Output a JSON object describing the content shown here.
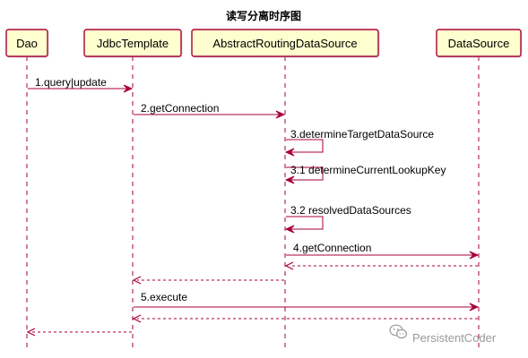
{
  "title": "读写分离时序图",
  "colors": {
    "participant_fill": "#FEFECE",
    "participant_border": "#A80036",
    "arrow": "#A80036",
    "lifeline": "#A80036"
  },
  "participants": [
    {
      "id": "dao",
      "name": "Dao"
    },
    {
      "id": "jdbc",
      "name": "JdbcTemplate"
    },
    {
      "id": "ards",
      "name": "AbstractRoutingDataSource"
    },
    {
      "id": "ds",
      "name": "DataSource"
    }
  ],
  "messages": [
    {
      "from": "dao",
      "to": "jdbc",
      "label": "1.query|update",
      "dashed": false
    },
    {
      "from": "jdbc",
      "to": "ards",
      "label": "2.getConnection",
      "dashed": false
    },
    {
      "from": "ards",
      "to": "ards",
      "label": "3.determineTargetDataSource",
      "dashed": false
    },
    {
      "from": "ards",
      "to": "ards",
      "label": "3.1 determineCurrentLookupKey",
      "dashed": false
    },
    {
      "from": "ards",
      "to": "ards",
      "label": "3.2 resolvedDataSources",
      "dashed": false
    },
    {
      "from": "ards",
      "to": "ds",
      "label": "4.getConnection",
      "dashed": false
    },
    {
      "from": "ds",
      "to": "ards",
      "label": "",
      "dashed": true
    },
    {
      "from": "ards",
      "to": "jdbc",
      "label": "",
      "dashed": true
    },
    {
      "from": "jdbc",
      "to": "ds",
      "label": "5.execute",
      "dashed": false
    },
    {
      "from": "ds",
      "to": "jdbc",
      "label": "",
      "dashed": true
    },
    {
      "from": "jdbc",
      "to": "dao",
      "label": "",
      "dashed": true
    }
  ],
  "watermark": {
    "icon": "wechat-icon",
    "text": "PersistentCoder"
  }
}
